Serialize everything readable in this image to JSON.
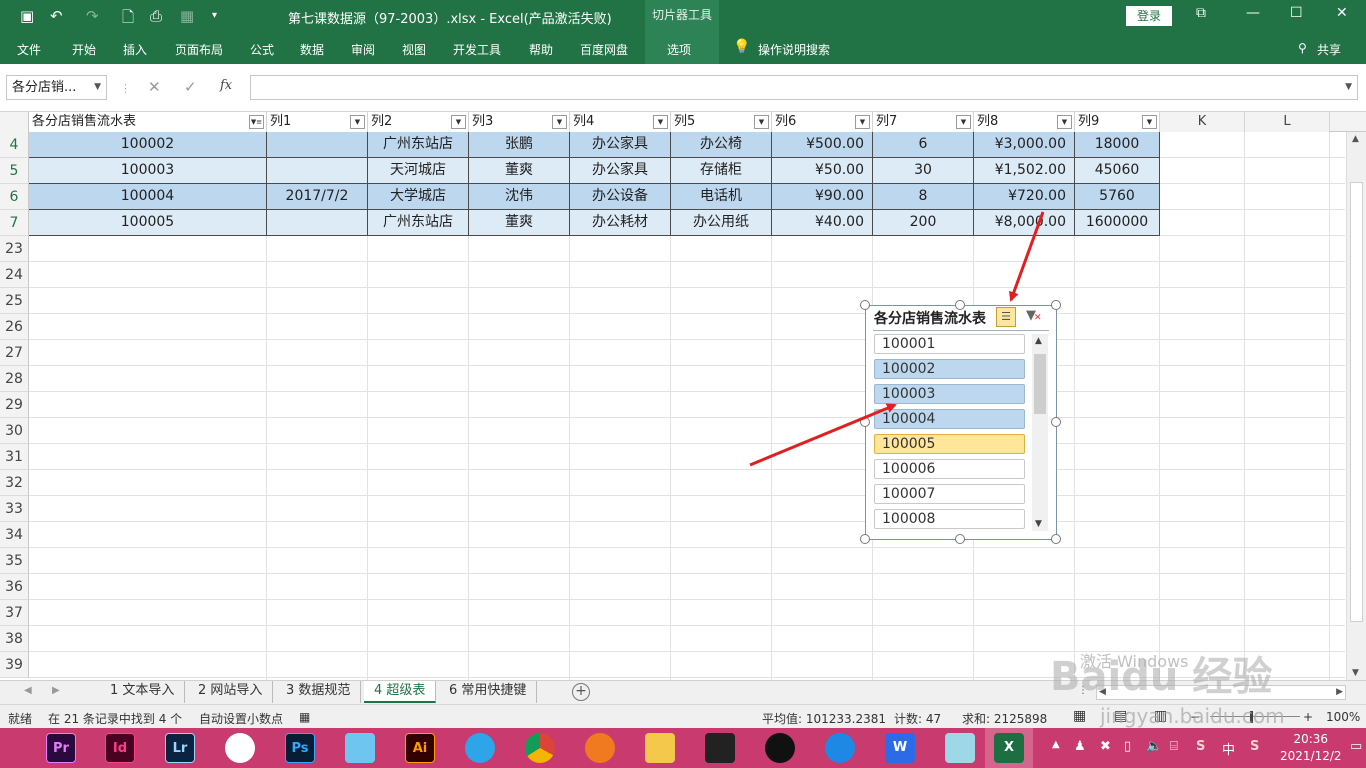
{
  "titlebar": {
    "doc_title": "第七课数据源（97-2003）.xlsx  -  Excel(产品激活失败)",
    "context_tab": "切片器工具",
    "login": "登录",
    "minimize": "—",
    "maximize": "☐",
    "close": "✕"
  },
  "ribbon": {
    "tabs": [
      "文件",
      "开始",
      "插入",
      "页面布局",
      "公式",
      "数据",
      "审阅",
      "视图",
      "开发工具",
      "帮助",
      "百度网盘",
      "选项"
    ],
    "tell_me": "操作说明搜索",
    "share": "共享"
  },
  "formula_bar": {
    "name_box": "各分店销...",
    "formula_value": ""
  },
  "columns": [
    {
      "label": "各分店销售流水表",
      "filtered": true
    },
    {
      "label": "列1",
      "filtered": false
    },
    {
      "label": "列2",
      "filtered": false
    },
    {
      "label": "列3",
      "filtered": false
    },
    {
      "label": "列4",
      "filtered": false
    },
    {
      "label": "列5",
      "filtered": false
    },
    {
      "label": "列6",
      "filtered": false
    },
    {
      "label": "列7",
      "filtered": false
    },
    {
      "label": "列8",
      "filtered": false
    },
    {
      "label": "列9",
      "filtered": false
    },
    {
      "label": "K",
      "filtered": false
    },
    {
      "label": "L",
      "filtered": false
    }
  ],
  "rows": [
    {
      "num": "4",
      "cells": [
        "100002",
        "",
        "广州东站店",
        "张鹏",
        "办公家具",
        "办公椅",
        "¥500.00",
        "6",
        "¥3,000.00",
        "18000"
      ]
    },
    {
      "num": "5",
      "cells": [
        "100003",
        "",
        "天河城店",
        "董爽",
        "办公家具",
        "存储柜",
        "¥50.00",
        "30",
        "¥1,502.00",
        "45060"
      ]
    },
    {
      "num": "6",
      "cells": [
        "100004",
        "2017/7/2",
        "大学城店",
        "沈伟",
        "办公设备",
        "电话机",
        "¥90.00",
        "8",
        "¥720.00",
        "5760"
      ]
    },
    {
      "num": "7",
      "cells": [
        "100005",
        "",
        "广州东站店",
        "董爽",
        "办公耗材",
        "办公用纸",
        "¥40.00",
        "200",
        "¥8,000.00",
        "1600000"
      ]
    }
  ],
  "empty_row_numbers": [
    "23",
    "24",
    "25",
    "26",
    "27",
    "28",
    "29",
    "30",
    "31",
    "32",
    "33",
    "34",
    "35",
    "36",
    "37",
    "38",
    "39"
  ],
  "slicer": {
    "title": "各分店销售流水表",
    "items": [
      {
        "label": "100001",
        "state": "normal"
      },
      {
        "label": "100002",
        "state": "selected"
      },
      {
        "label": "100003",
        "state": "selected"
      },
      {
        "label": "100004",
        "state": "selected"
      },
      {
        "label": "100005",
        "state": "hover"
      },
      {
        "label": "100006",
        "state": "normal"
      },
      {
        "label": "100007",
        "state": "normal"
      },
      {
        "label": "100008",
        "state": "normal"
      }
    ]
  },
  "sheets": [
    {
      "label": "1 文本导入",
      "active": false
    },
    {
      "label": "2 网站导入",
      "active": false
    },
    {
      "label": "3 数据规范",
      "active": false
    },
    {
      "label": "4 超级表",
      "active": true
    },
    {
      "label": "6 常用快捷键",
      "active": false
    }
  ],
  "status": {
    "ready": "就绪",
    "records": "在 21 条记录中找到 4 个",
    "auto_decimal": "自动设置小数点",
    "average": "平均值: 101233.2381",
    "count": "计数: 47",
    "sum": "求和: 2125898",
    "zoom": "100%"
  },
  "taskbar": {
    "apps": [
      "Pr",
      "Id",
      "Lr",
      "",
      "Ps",
      "",
      "Ai",
      "",
      "",
      "",
      "",
      "",
      "",
      "",
      "W",
      "",
      "X"
    ],
    "time": "20:36",
    "date": "2021/12/2"
  },
  "watermark": {
    "activate": "激活 Windows",
    "brand": "Baidu 经验",
    "url": "jingyan.baidu.com"
  },
  "colors": {
    "excel_green": "#217346",
    "band_dark": "#bdd7ee",
    "band_light": "#ddebf7",
    "slicer_hover": "#ffe699",
    "taskbar": "#c93a6e",
    "arrow": "#e02020"
  }
}
